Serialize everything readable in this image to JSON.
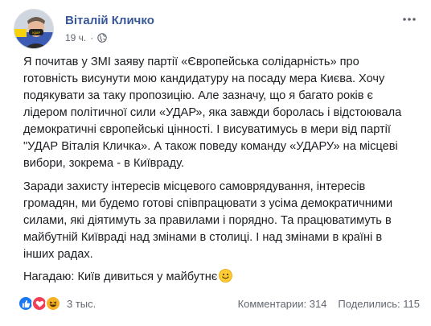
{
  "post": {
    "author": "Віталій Кличко",
    "time": "19 ч.",
    "time_separator": "·",
    "paragraphs": [
      "Я почитав у ЗМІ заяву партії «Європейська солідарність» про готовність висунути мою кандидатуру на посаду мера Києва. Хочу подякувати за таку пропозицію. Але зазначу, що я багато років є лідером політичної сили «УДАР», яка завжди боролась і відстоювала демократичні європейські цінності. І висуватимусь в мери від партії \"УДАР Віталія Кличка». А також поведу команду «УДАРУ» на місцеві вибори, зокрема - в Київраду.",
      "Заради захисту інтересів місцевого самоврядування, інтересів громадян, ми будемо готові співпрацювати з усіма демократичними силами, які діятимуть за правилами і порядно. Та працюватимуть в майбутній Київраді над змінами в столиці. І над змінами в країні в інших радах.",
      "Нагадаю: Київ дивиться у майбутнє"
    ],
    "icons": {
      "avatar": "avatar-icon",
      "privacy": "globe-icon",
      "more": "more-icon",
      "emoji": "smile-emoji-icon"
    }
  },
  "footer": {
    "reaction_icons": [
      "like-icon",
      "love-icon",
      "haha-icon"
    ],
    "reaction_count": "3 тыс.",
    "comments": "Комментарии: 314",
    "shares": "Поделились: 115"
  },
  "colors": {
    "author": "#385898",
    "meta": "#616770",
    "like": "#1877f2",
    "love": "#f33e58",
    "haha": "#f7b125"
  }
}
